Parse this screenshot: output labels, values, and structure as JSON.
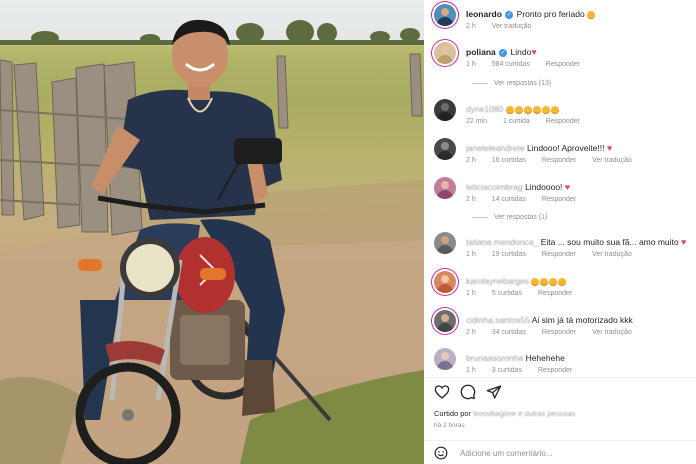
{
  "comments": [
    {
      "user": "leonardo",
      "verified": true,
      "text": "Pronto pro feriado",
      "emojis": 1,
      "time": "2 h",
      "likes": "",
      "reply": "",
      "translate": "Ver tradução"
    },
    {
      "user": "poliana",
      "verified": true,
      "text": "Lindo",
      "heart": true,
      "time": "1 h",
      "likes": "584 curtidas",
      "reply": "Responder",
      "translate": ""
    },
    {
      "user": "dyne1080",
      "text": "",
      "emojis": 6,
      "time": "22 min",
      "likes": "1 curtida",
      "reply": "Responder",
      "translate": ""
    },
    {
      "user": "janeteleandrete",
      "text": "Lindooo! Aproveite!!!",
      "heart": true,
      "time": "2 h",
      "likes": "16 curtidas",
      "reply": "Responder",
      "translate": "Ver tradução"
    },
    {
      "user": "leticiacoimbrag",
      "text": "Lindoooo!",
      "heart": true,
      "time": "2 h",
      "likes": "14 curtidas",
      "reply": "Responder",
      "translate": ""
    },
    {
      "user": "tatiana.mendonca_",
      "text": "Eita ... sou muito sua fã... amo muito",
      "heart": true,
      "time": "1 h",
      "likes": "19 curtidas",
      "reply": "Responder",
      "translate": "Ver tradução"
    },
    {
      "user": "karolaynebarges",
      "text": "",
      "emojis": 4,
      "time": "1 h",
      "likes": "5 curtidas",
      "reply": "Responder",
      "translate": ""
    },
    {
      "user": "cidinha.santos55",
      "text": "Ai sim já tá motorizado kkk",
      "time": "2 h",
      "likes": "34 curtidas",
      "reply": "Responder",
      "translate": "Ver tradução"
    },
    {
      "user": "brunaasoronha",
      "text": "Hehehehe",
      "time": "1 h",
      "likes": "3 curtidas",
      "reply": "Responder",
      "translate": ""
    }
  ],
  "view_replies": [
    {
      "label": "Ver respostas (13)"
    },
    {
      "label": "Ver respostas (1)"
    }
  ],
  "liked_by": {
    "prefix": "Curtido por",
    "users": "leoovbagone e outras pessoas"
  },
  "posted_ago": "há 2 horas",
  "add_comment_placeholder": "Adicione um comentário...",
  "icons": [
    "heart-icon",
    "comment-icon",
    "share-icon",
    "smile-icon"
  ],
  "colors": {
    "verified": "#3897f0",
    "heart": "#ed4956",
    "muted": "#8e8e8e"
  }
}
